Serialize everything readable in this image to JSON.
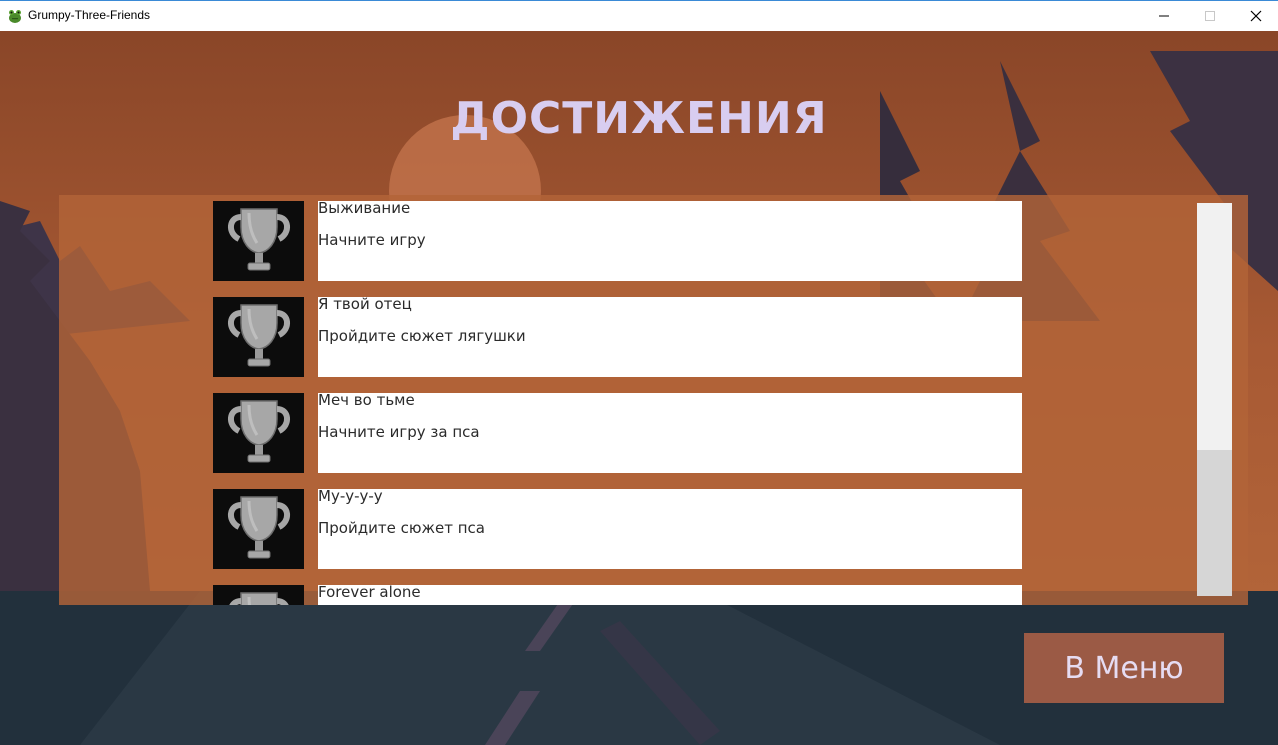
{
  "window": {
    "title": "Grumpy-Three-Friends",
    "controls": [
      "minimize",
      "maximize",
      "close"
    ]
  },
  "screen": {
    "heading": "ДОСТИЖЕНИЯ",
    "achievements": [
      {
        "title": "Выживание",
        "description": "Начните игру",
        "icon": "trophy-icon"
      },
      {
        "title": "Я твой отец",
        "description": "Пройдите сюжет лягушки",
        "icon": "trophy-icon"
      },
      {
        "title": "Меч во тьме",
        "description": "Начните игру за пса",
        "icon": "trophy-icon"
      },
      {
        "title": "Му-у-у-у",
        "description": "Пройдите сюжет пса",
        "icon": "trophy-icon"
      },
      {
        "title": "Forever alone",
        "description": "",
        "icon": "trophy-icon"
      }
    ],
    "scroll_position": 0.64,
    "menu_button": "В Меню"
  },
  "colors": {
    "heading": "#d8cdf0",
    "panel": "#b26438",
    "menu_button": "#9b5a45",
    "sky": "#8c4a2a",
    "ground": "#22303c"
  }
}
